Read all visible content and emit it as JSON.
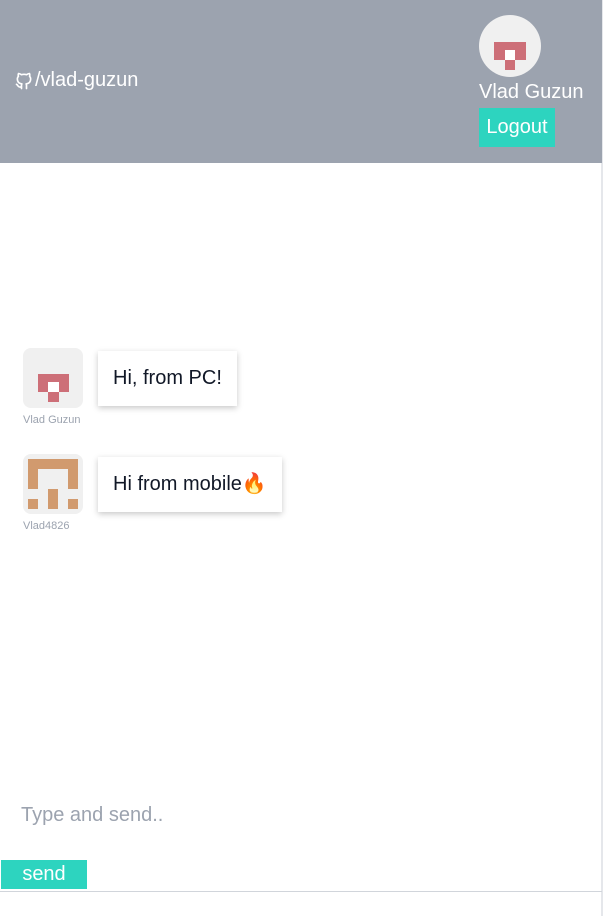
{
  "header": {
    "repo_link_text": "/vlad-guzun",
    "user_name": "Vlad Guzun",
    "logout_label": "Logout"
  },
  "messages": [
    {
      "author": "Vlad Guzun",
      "text": "Hi, from PC!",
      "avatar_icon": "identicon-red"
    },
    {
      "author": "Vlad4826",
      "text": "Hi from mobile🔥",
      "avatar_icon": "identicon-tan"
    }
  ],
  "composer": {
    "placeholder": "Type and send..",
    "value": "",
    "send_label": "send"
  },
  "colors": {
    "header_bg": "#9ca3af",
    "accent": "#2dd4bf",
    "identicon_red": "#cd6f78",
    "identicon_tan": "#d19a6e",
    "avatar_bg": "#f0f0f0"
  }
}
